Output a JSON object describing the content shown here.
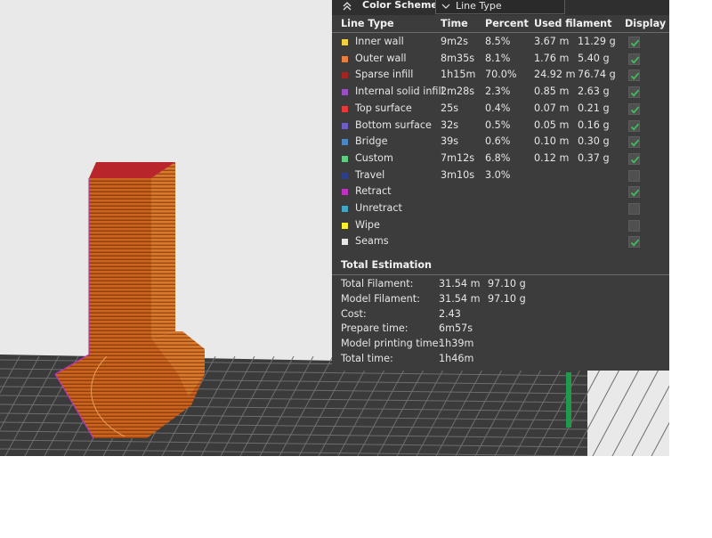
{
  "header": {
    "collapse_icon": "chevron-up-double-icon",
    "color_scheme_label": "Color Scheme",
    "scheme_value": "Line Type"
  },
  "columns": {
    "line_type": "Line Type",
    "time": "Time",
    "percent": "Percent",
    "used_filament": "Used filament",
    "display": "Display"
  },
  "line_types": [
    {
      "name": "Inner wall",
      "color": "#f2d23b",
      "time": "9m2s",
      "percent": "8.5%",
      "length": "3.67 m",
      "weight": "11.29 g",
      "display": true
    },
    {
      "name": "Outer wall",
      "color": "#ed7d3a",
      "time": "8m35s",
      "percent": "8.1%",
      "length": "1.76 m",
      "weight": "5.40 g",
      "display": true
    },
    {
      "name": "Sparse infill",
      "color": "#a42424",
      "time": "1h15m",
      "percent": "70.0%",
      "length": "24.92 m",
      "weight": "76.74 g",
      "display": true
    },
    {
      "name": "Internal solid infill",
      "color": "#9b4fc2",
      "time": "2m28s",
      "percent": "2.3%",
      "length": "0.85 m",
      "weight": "2.63 g",
      "display": true
    },
    {
      "name": "Top surface",
      "color": "#e8383a",
      "time": "25s",
      "percent": "0.4%",
      "length": "0.07 m",
      "weight": "0.21 g",
      "display": true
    },
    {
      "name": "Bottom surface",
      "color": "#6d5dc8",
      "time": "32s",
      "percent": "0.5%",
      "length": "0.05 m",
      "weight": "0.16 g",
      "display": true
    },
    {
      "name": "Bridge",
      "color": "#4c86c6",
      "time": "39s",
      "percent": "0.6%",
      "length": "0.10 m",
      "weight": "0.30 g",
      "display": true
    },
    {
      "name": "Custom",
      "color": "#5bcf7f",
      "time": "7m12s",
      "percent": "6.8%",
      "length": "0.12 m",
      "weight": "0.37 g",
      "display": true
    },
    {
      "name": "Travel",
      "color": "#2b3f8c",
      "time": "3m10s",
      "percent": "3.0%",
      "length": "",
      "weight": "",
      "display": false
    },
    {
      "name": "Retract",
      "color": "#c232c2",
      "time": "",
      "percent": "",
      "length": "",
      "weight": "",
      "display": true
    },
    {
      "name": "Unretract",
      "color": "#3fa8c8",
      "time": "",
      "percent": "",
      "length": "",
      "weight": "",
      "display": false
    },
    {
      "name": "Wipe",
      "color": "#f7f02a",
      "time": "",
      "percent": "",
      "length": "",
      "weight": "",
      "display": false
    },
    {
      "name": "Seams",
      "color": "#e6e6e6",
      "time": "",
      "percent": "",
      "length": "",
      "weight": "",
      "display": true
    }
  ],
  "total_estimation": {
    "title": "Total Estimation",
    "rows": [
      {
        "label": "Total Filament:",
        "value1": "31.54 m",
        "value2": "97.10 g"
      },
      {
        "label": "Model Filament:",
        "value1": "31.54 m",
        "value2": "97.10 g"
      },
      {
        "label": "Cost:",
        "value1": "2.43",
        "value2": ""
      },
      {
        "label": "Prepare time:",
        "value1": "6m57s",
        "value2": ""
      },
      {
        "label": "Model printing time:",
        "value1": "1h39m",
        "value2": ""
      },
      {
        "label": "Total time:",
        "value1": "1h46m",
        "value2": ""
      }
    ]
  },
  "colors": {
    "check_green": "#3cbf5a",
    "model_orange": "#cf6a22",
    "top_red": "#b8262b",
    "plate_dark": "#3a3a3a"
  }
}
